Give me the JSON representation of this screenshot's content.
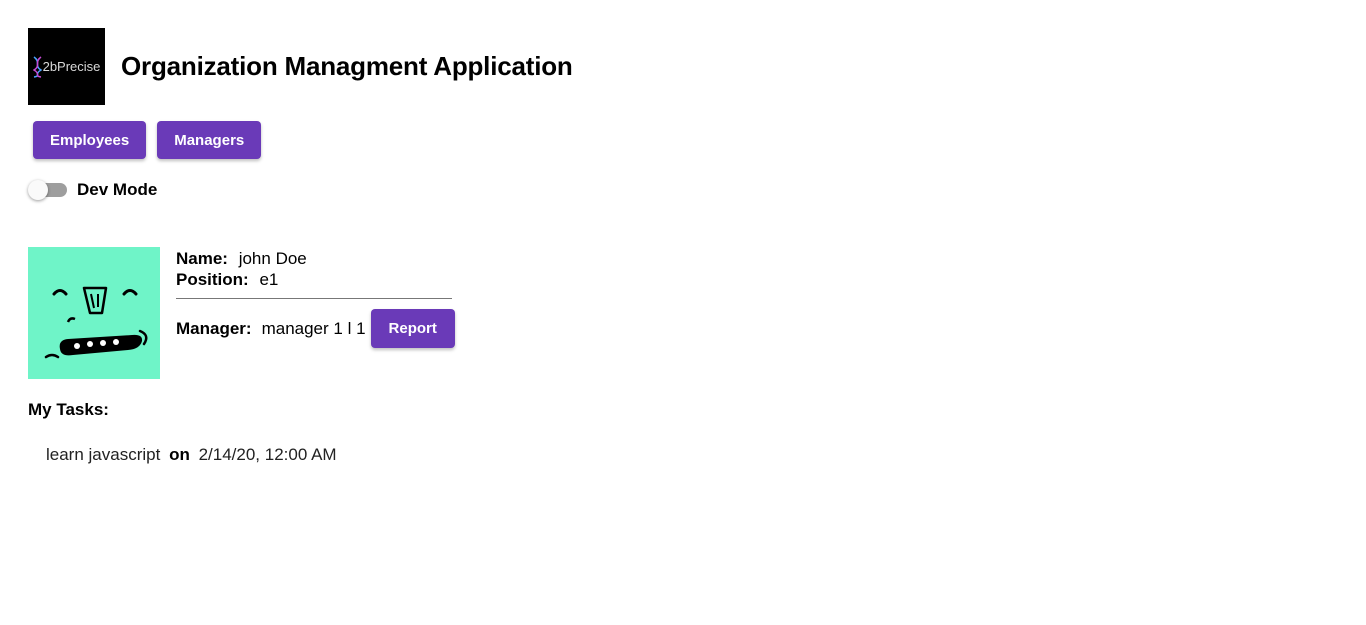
{
  "header": {
    "logo_text": "2bPrecise",
    "title": "Organization Managment Application"
  },
  "nav": {
    "employees_label": "Employees",
    "managers_label": "Managers"
  },
  "dev_mode": {
    "label": "Dev Mode",
    "enabled": false
  },
  "profile": {
    "name_label": "Name:",
    "name_value": "john Doe",
    "position_label": "Position:",
    "position_value": "e1",
    "manager_label": "Manager:",
    "manager_value": "manager 1 l 1",
    "report_label": "Report"
  },
  "tasks": {
    "title": "My Tasks:",
    "items": [
      {
        "text": "learn javascript",
        "connector": "on",
        "date": "2/14/20, 12:00 AM"
      }
    ]
  },
  "colors": {
    "accent": "#6a3ab8",
    "avatar_bg": "#6ff4c8"
  }
}
